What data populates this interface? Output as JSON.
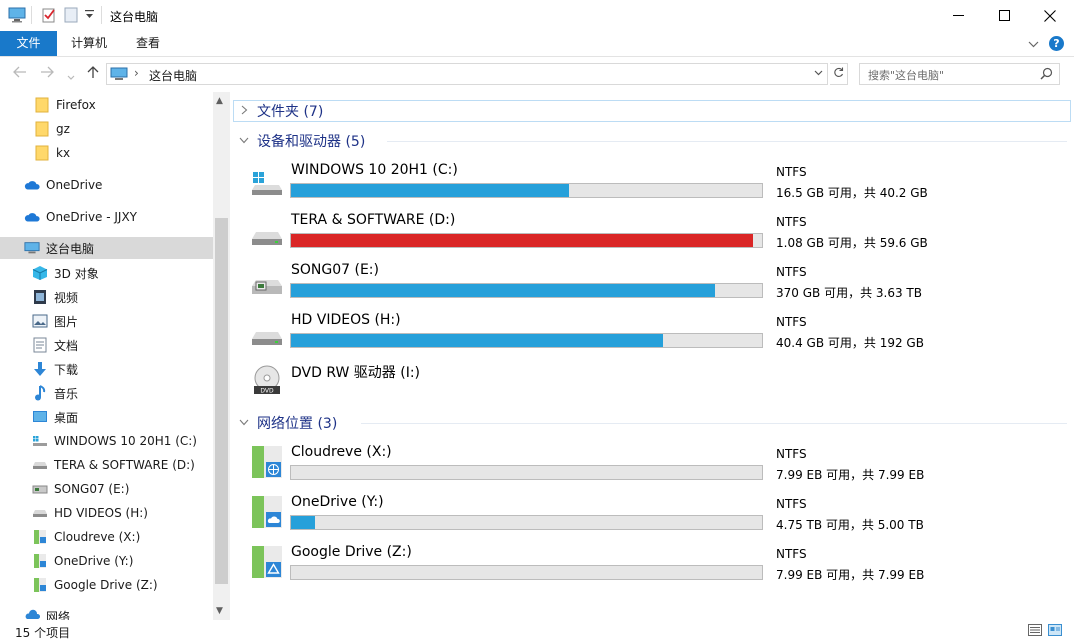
{
  "window": {
    "title": "这台电脑",
    "minimize_icon": "minimize-icon",
    "maximize_icon": "maximize-icon",
    "close_icon": "close-icon"
  },
  "ribbon": {
    "tabs": [
      "文件",
      "计算机",
      "查看"
    ],
    "file_color": "#1979ca",
    "help_label": "?"
  },
  "address": {
    "crumb": "这台电脑",
    "search_placeholder": "搜索\"这台电脑\""
  },
  "sidebar": {
    "items": [
      {
        "label": "Firefox",
        "icon": "folder-icon"
      },
      {
        "label": "gz",
        "icon": "folder-icon"
      },
      {
        "label": "kx",
        "icon": "folder-icon"
      },
      {
        "label": "OneDrive",
        "icon": "cloud-icon"
      },
      {
        "label": "OneDrive - JJXY",
        "icon": "cloud-icon"
      },
      {
        "label": "这台电脑",
        "icon": "computer-icon",
        "selected": true
      },
      {
        "label": "3D 对象",
        "icon": "3d-objects-icon"
      },
      {
        "label": "视频",
        "icon": "video-icon"
      },
      {
        "label": "图片",
        "icon": "pictures-icon"
      },
      {
        "label": "文档",
        "icon": "documents-icon"
      },
      {
        "label": "下载",
        "icon": "download-icon"
      },
      {
        "label": "音乐",
        "icon": "music-icon"
      },
      {
        "label": "桌面",
        "icon": "desktop-icon"
      },
      {
        "label": "WINDOWS 10 20H1 (C:)",
        "icon": "windows-drive-icon"
      },
      {
        "label": "TERA & SOFTWARE (D:)",
        "icon": "drive-icon"
      },
      {
        "label": "SONG07 (E:)",
        "icon": "network-drive-icon"
      },
      {
        "label": "HD  VIDEOS (H:)",
        "icon": "drive-icon"
      },
      {
        "label": "Cloudreve (X:)",
        "icon": "cloud-drive-icon"
      },
      {
        "label": "OneDrive (Y:)",
        "icon": "cloud-drive-icon"
      },
      {
        "label": "Google Drive (Z:)",
        "icon": "cloud-drive-icon"
      },
      {
        "label": "网络",
        "icon": "network-icon"
      }
    ]
  },
  "groups": {
    "folders": "文件夹 (7)",
    "devices": "设备和驱动器 (5)",
    "network": "网络位置 (3)"
  },
  "devices": [
    {
      "name": "WINDOWS 10 20H1 (C:)",
      "fs": "NTFS",
      "free": "16.5 GB 可用，共 40.2 GB",
      "used_fraction": 0.59,
      "color": "#26a0da",
      "icon": "windows-drive-icon"
    },
    {
      "name": "TERA & SOFTWARE (D:)",
      "fs": "NTFS",
      "free": "1.08 GB 可用，共 59.6 GB",
      "used_fraction": 0.98,
      "color": "#da2626",
      "icon": "drive-icon"
    },
    {
      "name": "SONG07 (E:)",
      "fs": "NTFS",
      "free": "370 GB 可用，共 3.63 TB",
      "used_fraction": 0.9,
      "color": "#26a0da",
      "icon": "network-drive-icon"
    },
    {
      "name": "HD  VIDEOS (H:)",
      "fs": "NTFS",
      "free": "40.4 GB 可用，共 192 GB",
      "used_fraction": 0.79,
      "color": "#26a0da",
      "icon": "drive-icon"
    },
    {
      "name": "DVD RW 驱动器 (I:)",
      "icon": "dvd-drive-icon"
    }
  ],
  "network_locations": [
    {
      "name": "Cloudreve (X:)",
      "fs": "NTFS",
      "free": "7.99 EB 可用，共 7.99 EB",
      "used_fraction": 0.0,
      "icon": "globe-drive-icon"
    },
    {
      "name": "OneDrive (Y:)",
      "fs": "NTFS",
      "free": "4.75 TB 可用，共 5.00 TB",
      "used_fraction": 0.05,
      "icon": "onedrive-drive-icon"
    },
    {
      "name": "Google Drive (Z:)",
      "fs": "NTFS",
      "free": "7.99 EB 可用，共 7.99 EB",
      "used_fraction": 0.0,
      "icon": "google-drive-icon"
    }
  ],
  "status": {
    "count": "15 个项目"
  }
}
